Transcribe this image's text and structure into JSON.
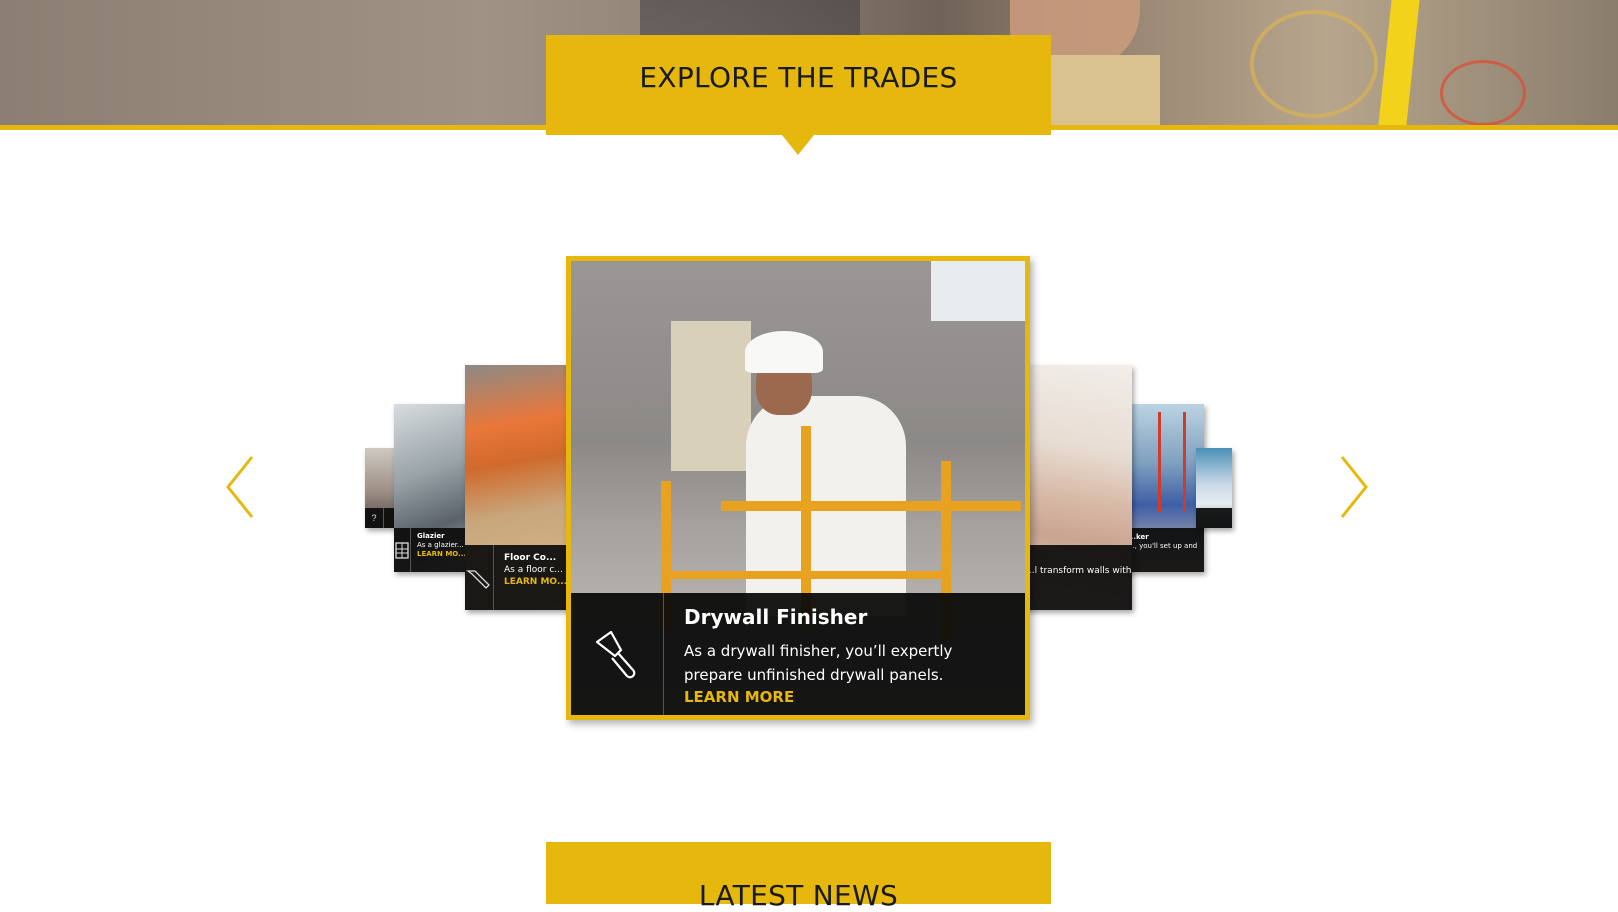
{
  "sections": {
    "explore_title": "EXPLORE THE TRADES",
    "news_title": "LATEST NEWS"
  },
  "colors": {
    "accent": "#e6b80e",
    "caption_bg": "#0a0a0a",
    "text_light": "#ffffff"
  },
  "carousel": {
    "prev_icon": "chevron-left-icon",
    "next_icon": "chevron-right-icon",
    "featured": {
      "title": "Drywall Finisher",
      "description": "As a drywall finisher, you’ll expertly prepare unfinished drywall panels.",
      "link": "LEARN MORE",
      "icon": "putty-knife-icon"
    },
    "left_cards": [
      {
        "title": "Glazier",
        "description_fragment": "As a glazier... types of gl...",
        "link_fragment": "LEARN MO...",
        "icon": "window-building-icon"
      },
      {
        "title_fragment": "Floor Co...",
        "description_fragment": "As a floor c... floors in di...",
        "link_fragment": "LEARN MO...",
        "icon": "floor-tool-icon"
      }
    ],
    "right_cards": [
      {
        "description_fragment": "...l transform walls with"
      },
      {
        "title_fragment": "...ker",
        "description_fragment": "..., you'll set up and"
      }
    ]
  }
}
